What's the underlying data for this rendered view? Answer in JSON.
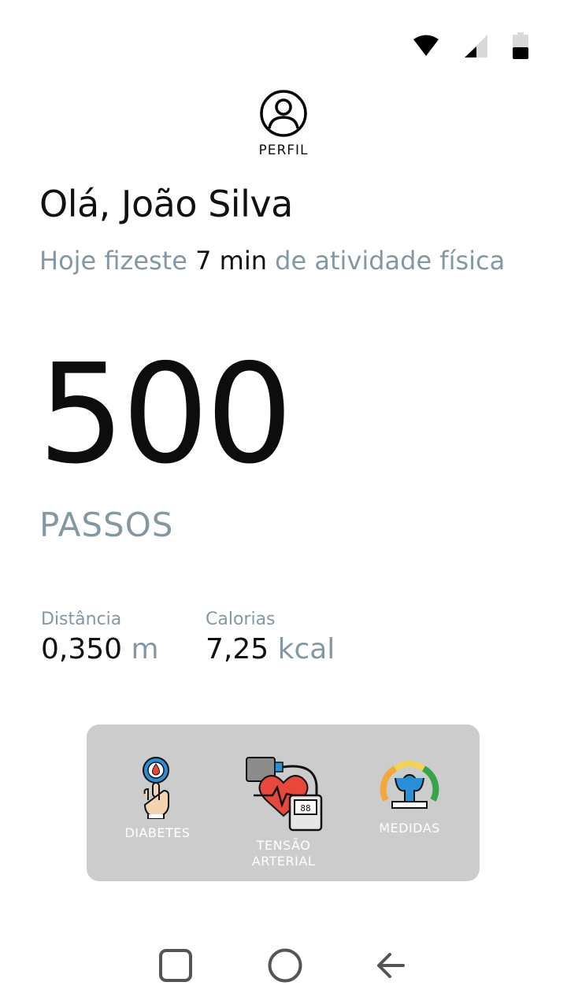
{
  "status_bar": {
    "icons": [
      "wifi-icon",
      "signal-icon",
      "battery-icon"
    ]
  },
  "profile": {
    "label": "PERFIL",
    "icon": "user-circle-icon"
  },
  "greeting": "Olá, João Silva",
  "activity": {
    "prefix": "Hoje fizeste ",
    "value": "7 min",
    "suffix": " de atividade física"
  },
  "steps": {
    "value": "500",
    "label": "PASSOS"
  },
  "metrics": [
    {
      "label": "Distância",
      "value": "0,350",
      "unit": "m"
    },
    {
      "label": "Calorias",
      "value": "7,25",
      "unit": "kcal"
    }
  ],
  "shortcuts": [
    {
      "label": "DIABETES",
      "icon": "diabetes-icon"
    },
    {
      "label": "TENSÃO ARTERIAL",
      "icon": "blood-pressure-icon"
    },
    {
      "label": "MEDIDAS",
      "icon": "measures-icon"
    }
  ],
  "nav": {
    "icons": [
      "recent-apps-icon",
      "home-icon",
      "back-icon"
    ]
  },
  "colors": {
    "muted_text": "#8398a3",
    "panel_bg": "#cccccc",
    "heart": "#e8483c",
    "accent_blue": "#2b8fd6"
  }
}
